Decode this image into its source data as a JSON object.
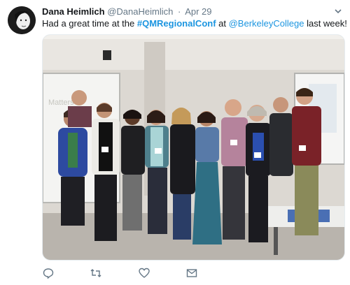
{
  "tweet": {
    "author_name": "Dana Heimlich",
    "author_handle": "@DanaHeimlich",
    "separator": "·",
    "date": "Apr 29",
    "text_before": "Had a great time at the ",
    "hashtag": "#QMRegionalConf",
    "text_middle": " at ",
    "mention": "@BerkeleyCollege",
    "text_after": " last week!"
  },
  "actions": [
    {
      "name": "reply",
      "icon": "reply-icon"
    },
    {
      "name": "retweet",
      "icon": "retweet-icon"
    },
    {
      "name": "like",
      "icon": "heart-icon"
    },
    {
      "name": "message",
      "icon": "envelope-icon"
    }
  ],
  "colors": {
    "accent": "#1b95e0",
    "muted": "#657786",
    "text": "#14171a"
  }
}
